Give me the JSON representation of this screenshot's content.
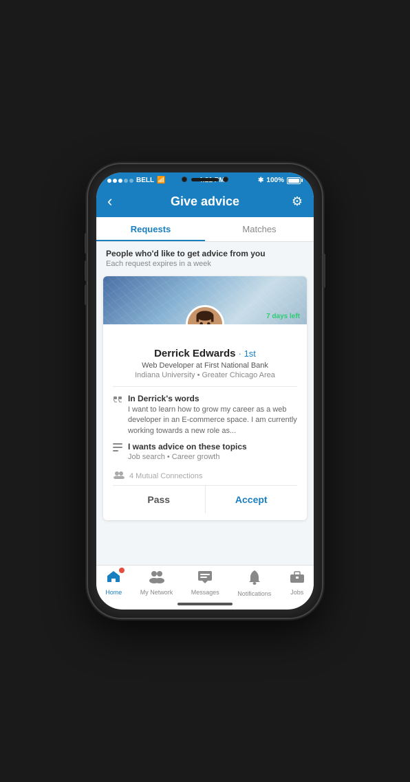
{
  "status": {
    "carrier": "BELL",
    "time": "4:21 PM",
    "battery": "100%"
  },
  "header": {
    "title": "Give advice",
    "back_label": "‹",
    "settings_label": "⚙"
  },
  "tabs": [
    {
      "id": "requests",
      "label": "Requests",
      "active": true
    },
    {
      "id": "matches",
      "label": "Matches",
      "active": false
    }
  ],
  "section": {
    "title": "People who'd like to get advice from you",
    "subtitle": "Each request expires in a week"
  },
  "profile": {
    "name": "Derrick Edwards",
    "degree": "· 1st",
    "job_title": "Web Developer at First National Bank",
    "education_location": "Indiana University • Greater Chicago Area",
    "days_left": "7 days left",
    "in_their_words_label": "In Derrick's words",
    "in_their_words_text": "I want to learn how to grow my career as a web developer in an E-commerce space. I am currently working towards a new role as...",
    "topics_label": "I wants advice on these topics",
    "topics_text": "Job search • Career growth",
    "connections_count": "4 Mutual Connections"
  },
  "actions": {
    "pass_label": "Pass",
    "accept_label": "Accept"
  },
  "bottom_nav": [
    {
      "id": "home",
      "label": "Home",
      "icon": "🏠",
      "active": true,
      "badge": true
    },
    {
      "id": "network",
      "label": "My Network",
      "icon": "👥",
      "active": false,
      "badge": false
    },
    {
      "id": "messages",
      "label": "Messages",
      "icon": "💬",
      "active": false,
      "badge": false
    },
    {
      "id": "notifications",
      "label": "Notifications",
      "icon": "🔔",
      "active": false,
      "badge": false
    },
    {
      "id": "jobs",
      "label": "Jobs",
      "icon": "💼",
      "active": false,
      "badge": false
    }
  ]
}
